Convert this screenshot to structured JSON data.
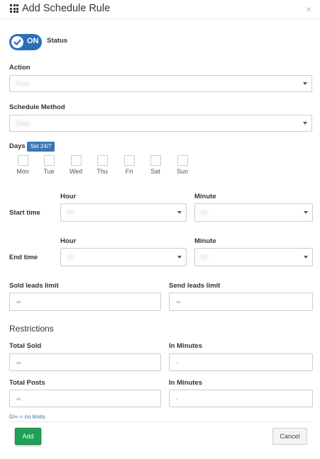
{
  "header": {
    "title": "Add Schedule Rule",
    "close_symbol": "×",
    "icon": "grid-icon"
  },
  "status": {
    "toggle_text": "ON",
    "label": "Status",
    "checked": true,
    "accent": "#2a6fb6"
  },
  "action": {
    "label": "Action",
    "value": "Post"
  },
  "schedule_method": {
    "label": "Schedule Method",
    "value": "Days"
  },
  "days": {
    "label": "Days",
    "badge": "Set 24/7",
    "items": [
      {
        "label": "Mon"
      },
      {
        "label": "Tue"
      },
      {
        "label": "Wed"
      },
      {
        "label": "Thu"
      },
      {
        "label": "Fri"
      },
      {
        "label": "Sat"
      },
      {
        "label": "Sun"
      }
    ]
  },
  "start_time": {
    "label": "Start time",
    "hour_label": "Hour",
    "minute_label": "Minute",
    "hour_value": "00",
    "minute_value": "00"
  },
  "end_time": {
    "label": "End time",
    "hour_label": "Hour",
    "minute_label": "Minute",
    "hour_value": "23",
    "minute_value": "59"
  },
  "limits": {
    "sold_label": "Sold leads limit",
    "sold_value": "∞",
    "send_label": "Send leads limit",
    "send_value": "∞"
  },
  "restrictions": {
    "title": "Restrictions",
    "total_sold_label": "Total Sold",
    "total_sold_value": "∞",
    "sold_minutes_label": "In Minutes",
    "sold_minutes_value": "-",
    "total_posts_label": "Total Posts",
    "total_posts_value": "∞",
    "posts_minutes_label": "In Minutes",
    "posts_minutes_value": "-"
  },
  "hint": "0/∞ = no limits",
  "footer": {
    "add_label": "Add",
    "cancel_label": "Cancel",
    "add_color": "#1fa055"
  }
}
